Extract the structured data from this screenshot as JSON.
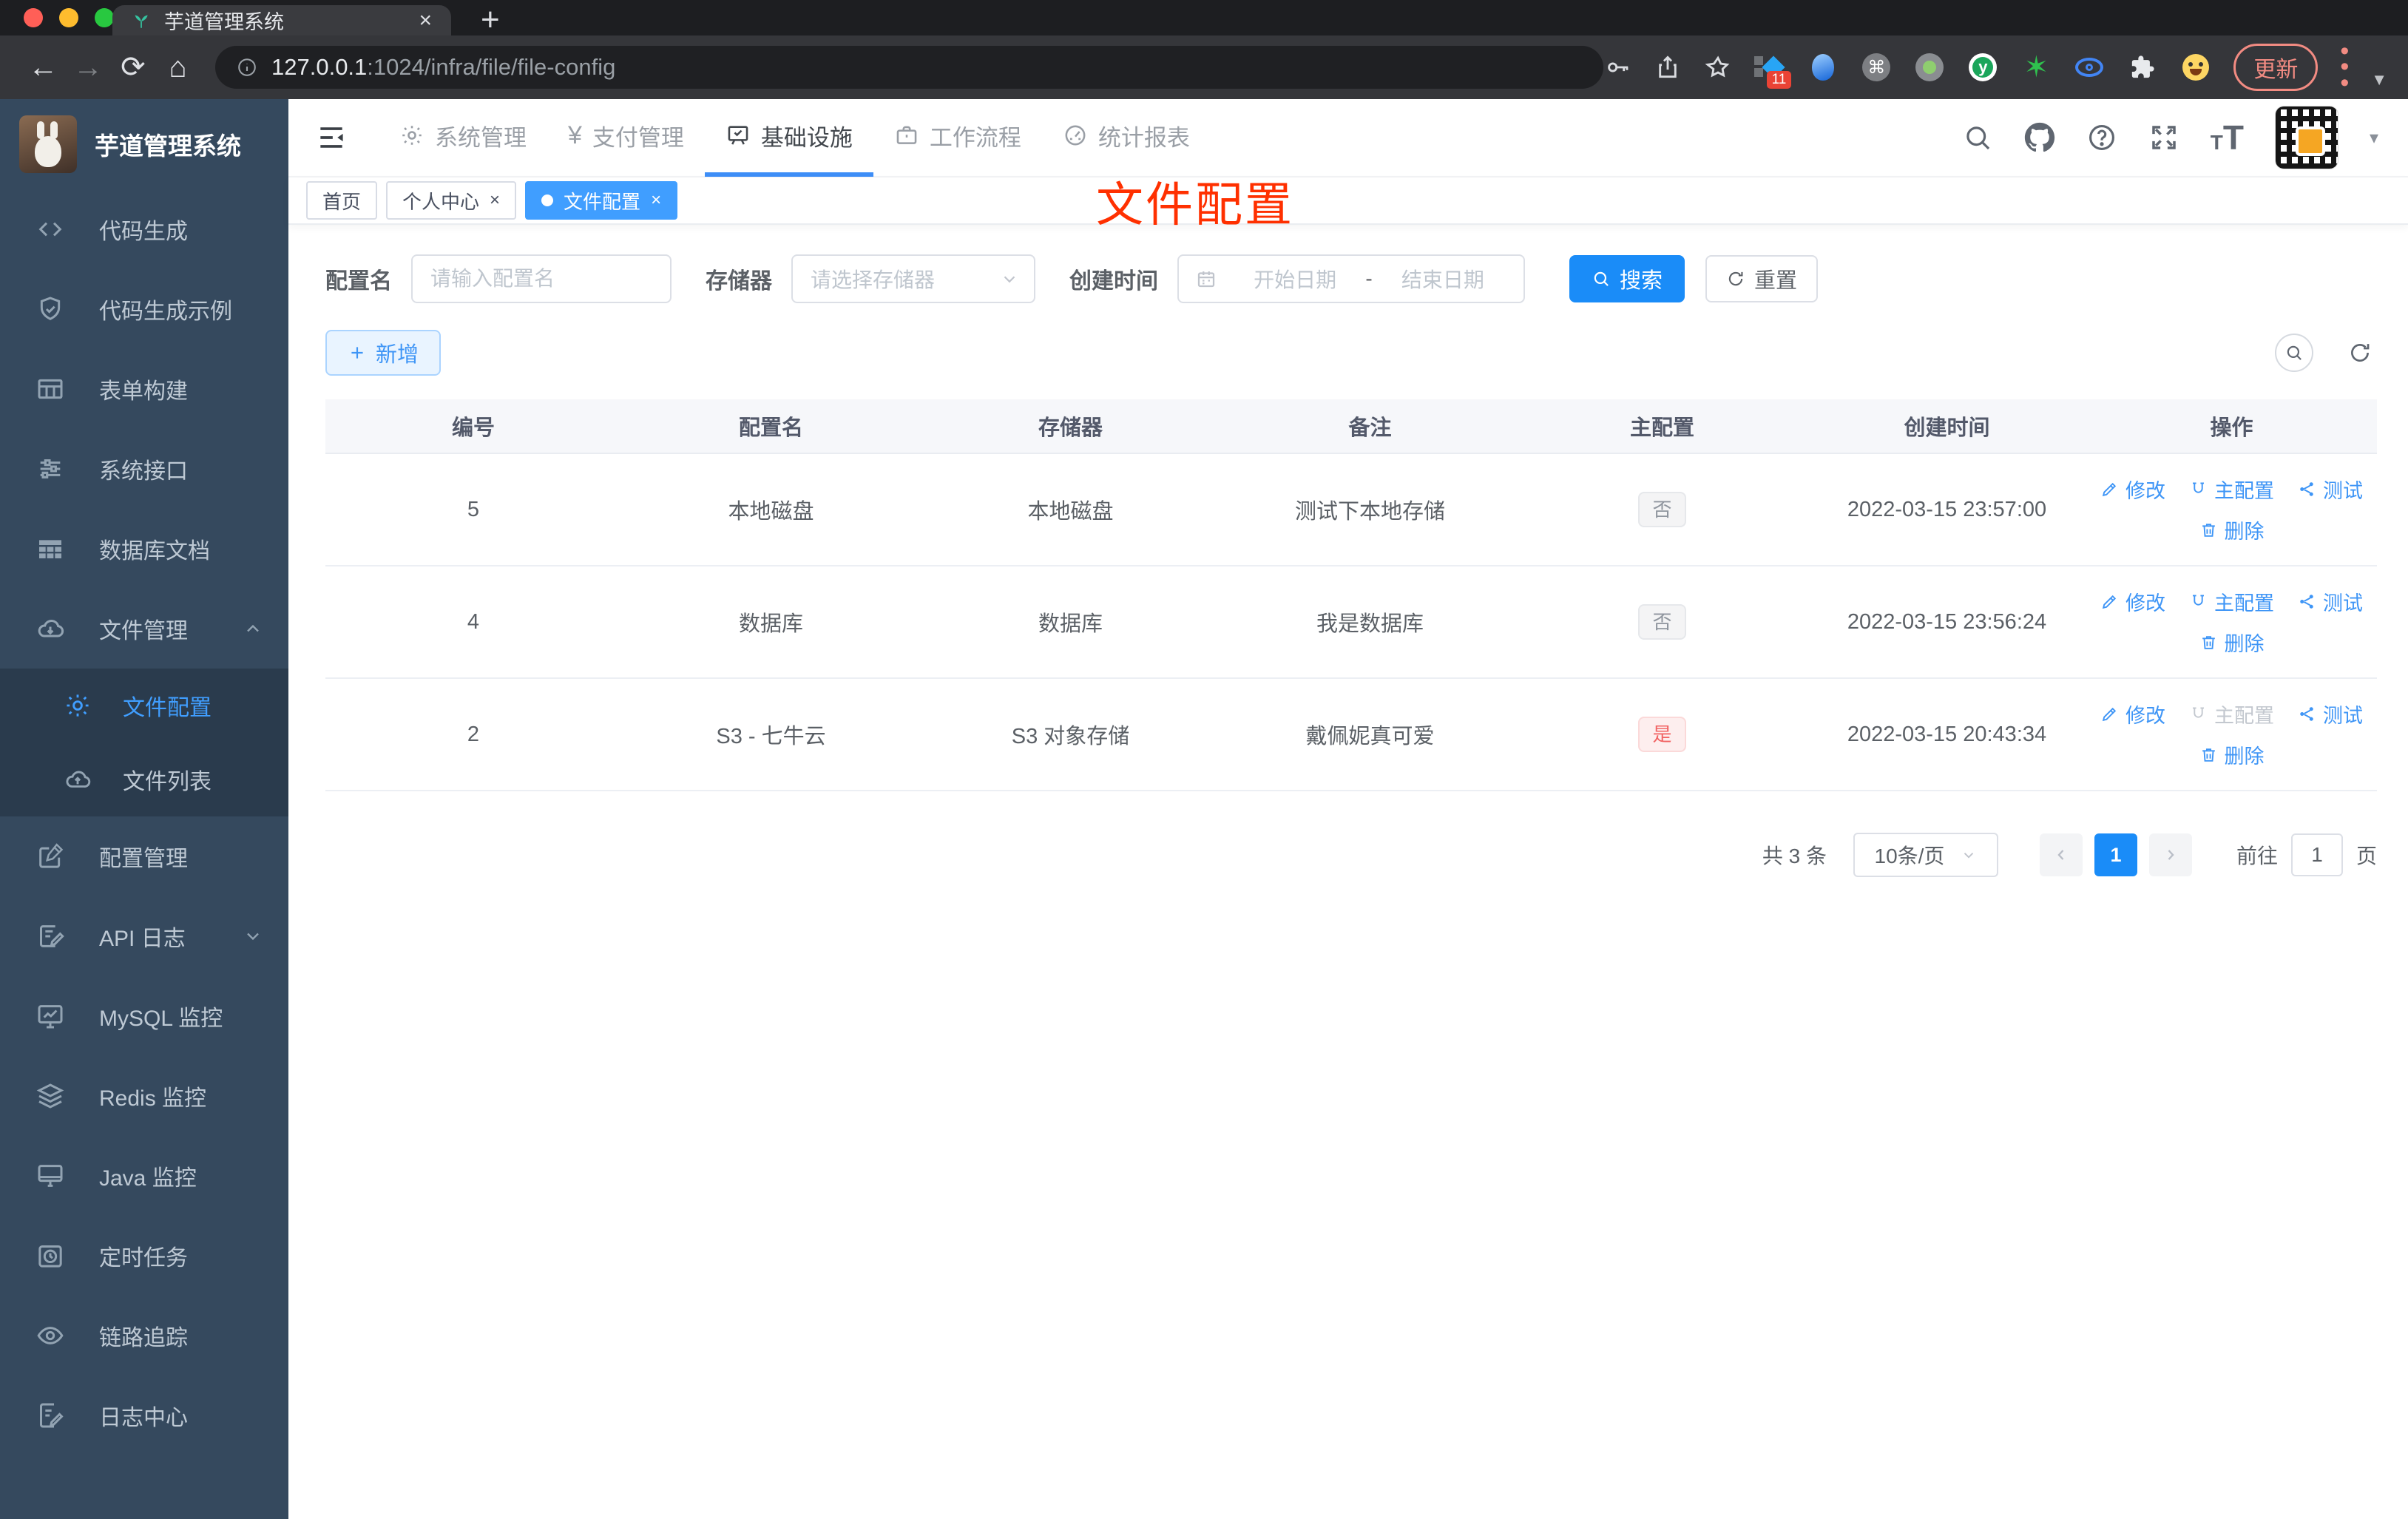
{
  "browser": {
    "tab_title": "芋道管理系统",
    "url_host": "127.0.0.1",
    "url_path": ":1024/infra/file/file-config",
    "update_label": "更新",
    "extension_badge": "11"
  },
  "icons": {
    "back": "←",
    "forward": "→",
    "reload": "⟳",
    "home": "⌂",
    "close": "×",
    "new_tab": "+",
    "command": "⌘",
    "y_letter": "y",
    "green_star": "✶",
    "yen": "¥",
    "font_size_small": "T",
    "font_size_large": "T",
    "caret_down": "▾",
    "window_caret": "▼",
    "menu_dots": "⋮"
  },
  "sidebar": {
    "title": "芋道管理系统",
    "items": [
      {
        "label": "代码生成"
      },
      {
        "label": "代码生成示例"
      },
      {
        "label": "表单构建"
      },
      {
        "label": "系统接口"
      },
      {
        "label": "数据库文档"
      },
      {
        "label": "文件管理"
      },
      {
        "label": "配置管理"
      },
      {
        "label": "API 日志"
      },
      {
        "label": "MySQL 监控"
      },
      {
        "label": "Redis 监控"
      },
      {
        "label": "Java 监控"
      },
      {
        "label": "定时任务"
      },
      {
        "label": "链路追踪"
      },
      {
        "label": "日志中心"
      }
    ],
    "submenu": [
      {
        "label": "文件配置"
      },
      {
        "label": "文件列表"
      }
    ]
  },
  "topnav": {
    "items": [
      {
        "label": "系统管理"
      },
      {
        "label": "支付管理"
      },
      {
        "label": "基础设施"
      },
      {
        "label": "工作流程"
      },
      {
        "label": "统计报表"
      }
    ]
  },
  "tags": [
    {
      "label": "首页"
    },
    {
      "label": "个人中心"
    },
    {
      "label": "文件配置"
    }
  ],
  "overlay_title": "文件配置",
  "filters": {
    "name_label": "配置名",
    "name_placeholder": "请输入配置名",
    "storage_label": "存储器",
    "storage_placeholder": "请选择存储器",
    "time_label": "创建时间",
    "start_placeholder": "开始日期",
    "range_separator": "-",
    "end_placeholder": "结束日期",
    "search_label": "搜索",
    "reset_label": "重置"
  },
  "toolbar": {
    "add_label": "新增"
  },
  "table": {
    "headers": [
      "编号",
      "配置名",
      "存储器",
      "备注",
      "主配置",
      "创建时间",
      "操作"
    ],
    "actions": {
      "edit": "修改",
      "master": "主配置",
      "test": "测试",
      "delete": "删除"
    },
    "rows": [
      {
        "id": "5",
        "name": "本地磁盘",
        "storage": "本地磁盘",
        "remark": "测试下本地存储",
        "master": "否",
        "created": "2022-03-15 23:57:00"
      },
      {
        "id": "4",
        "name": "数据库",
        "storage": "数据库",
        "remark": "我是数据库",
        "master": "否",
        "created": "2022-03-15 23:56:24"
      },
      {
        "id": "2",
        "name": "S3 - 七牛云",
        "storage": "S3 对象存储",
        "remark": "戴佩妮真可爱",
        "master": "是",
        "created": "2022-03-15 20:43:34"
      }
    ]
  },
  "pagination": {
    "total": "共 3 条",
    "page_size": "10条/页",
    "current_page": "1",
    "goto_label": "前往",
    "goto_value": "1",
    "page_unit": "页"
  },
  "colors": {
    "primary": "#409eff",
    "danger": "#f56c6c",
    "overlay_red": "#ff3000",
    "sidebar_bg": "#35495e"
  }
}
